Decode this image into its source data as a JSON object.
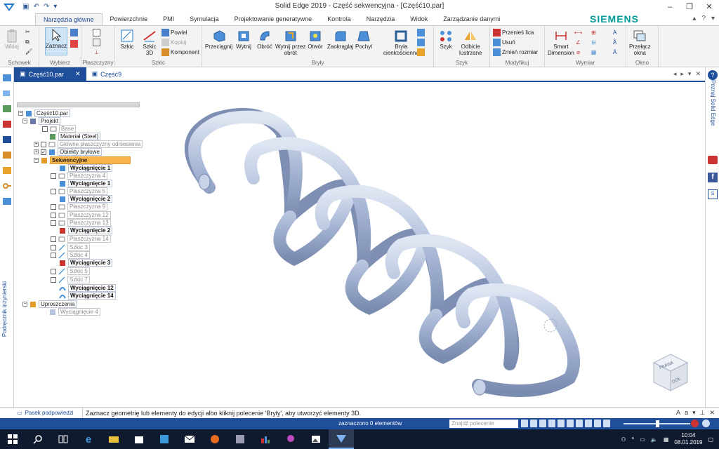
{
  "window": {
    "title": "Solid Edge 2019 - Część sekwencyjna - [Część10.par]",
    "brand": "SIEMENS",
    "controls": [
      "–",
      "❐",
      "✕"
    ]
  },
  "ribbon_tabs": [
    "Narzędzia główne",
    "Powierzchnie",
    "PMI",
    "Symulacja",
    "Projektowanie generatywne",
    "Kontrola",
    "Narzędzia",
    "Widok",
    "Zarządzanie danymi"
  ],
  "ribbon": {
    "schowek": {
      "label": "Schowek",
      "wklej": "Wklej"
    },
    "wybierz": {
      "label": "Wybierz",
      "zaznacz": "Zaznacz"
    },
    "plaszczyzny": {
      "label": "Płaszczyzny"
    },
    "szkic": {
      "label": "Szkic",
      "szkic": "Szkic",
      "szkic3d_1": "Szkic",
      "szkic3d_2": "3D",
      "powiel": "Powiel",
      "kopiuj": "Kopiuj",
      "komponent": "Komponent"
    },
    "bryly": {
      "label": "Bryły",
      "przeciagnij": "Przeciągnij",
      "wytnij": "Wytnij",
      "obroc": "Obróć",
      "wytnij_obrot_1": "Wytnij przez",
      "wytnij_obrot_2": "obrót",
      "otwor": "Otwór",
      "zaokraglaj": "Zaokrąglaj",
      "pochyl": "Pochyl",
      "bryla_1": "Bryła",
      "bryla_2": "cienkościenna"
    },
    "szyk": {
      "label": "Szyk",
      "szyk": "Szyk",
      "odbicie_1": "Odbicie",
      "odbicie_2": "lustrzane"
    },
    "modyfikuj": {
      "label": "Modyfikuj",
      "przenies": "Przenieś lica",
      "usun": "Usuń",
      "zmien": "Zmień rozmiar"
    },
    "wymiar": {
      "label": "Wymiar",
      "smart_1": "Smart",
      "smart_2": "Dimension"
    },
    "okno": {
      "label": "Okno",
      "przelacz_1": "Przełącz",
      "przelacz_2": "okna"
    }
  },
  "doc_tabs": [
    {
      "label": "Część10.par",
      "active": true
    },
    {
      "label": "Część9",
      "active": false
    }
  ],
  "tree": {
    "root": "Część10.par",
    "projekt": "Projekt",
    "items": [
      {
        "label": "Base",
        "style": "dim"
      },
      {
        "label": "Materiał (Steel)",
        "style": "normal"
      },
      {
        "label": "Główne płaszczyzny odniesienia",
        "style": "dim"
      },
      {
        "label": "Obiekty bryłowe",
        "style": "normal"
      }
    ],
    "sekwencyjne": "Sekwencyjne",
    "seq_items": [
      "Wyciągnięcie 1",
      "Płaszczyzna 4",
      "Wyciągnięcie 1",
      "Płaszczyzna 5",
      "Wyciągnięcie 2",
      "Płaszczyzna 9",
      "Płaszczyzna 12",
      "Płaszczyzna 13",
      "Wyciągnięcie 2",
      "Płaszczyzna 14",
      "Szkic 3",
      "Szkic 4",
      "Wyciągnięcie 3",
      "Szkic 5",
      "Szkic 7",
      "Wyciągnięcie 12",
      "Wyciągnięcie 14"
    ],
    "uproszczenia": "Uproszczenia",
    "upr_items": [
      "Wyciągnięcie 4"
    ]
  },
  "sidebar": {
    "left_label": "Podręcznik inżynierski",
    "right_label": "Poznaj Solid Edge"
  },
  "hint": {
    "label": "Pasek podpowiedzi",
    "text": "Zaznacz geometrię lub elementy do edycji albo kliknij polecenie 'Bryły', aby utworzyć elementy 3D."
  },
  "status": {
    "selection": "zaznaczono 0 elementów",
    "command_placeholder": "Znajdź polecenie"
  },
  "taskbar": {
    "time": "10:04",
    "date": "08.01.2019"
  },
  "viewcube": {
    "top": "PRAWA",
    "front": "DÓŁ"
  },
  "colors": {
    "accent": "#1f4e9b",
    "brand": "#009999",
    "highlight": "#f7b54a",
    "spring": "#a9b8d6"
  }
}
